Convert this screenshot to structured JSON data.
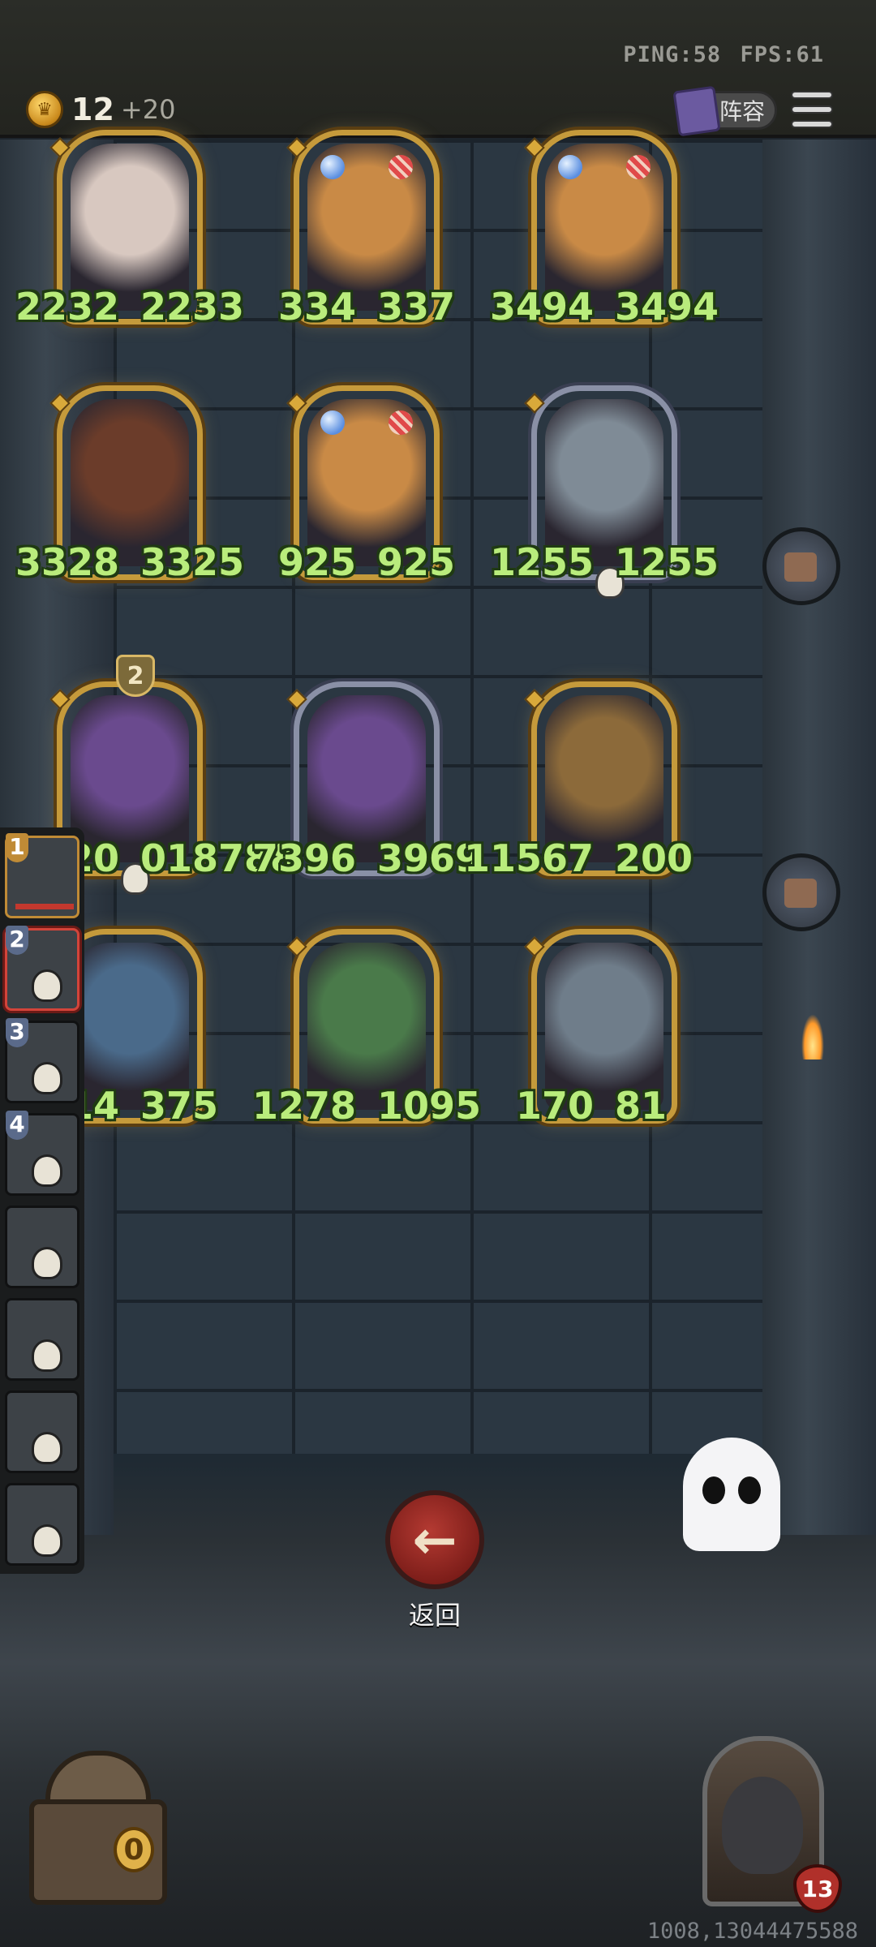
{
  "status": {
    "ping": "PING:58",
    "fps": "FPS:61"
  },
  "currency": {
    "gold": "12",
    "income": "+20"
  },
  "header": {
    "lineup_label": "阵容"
  },
  "cards": [
    {
      "atk": "2232",
      "hp": "2233",
      "frame": "gold",
      "portrait": "rabbit-mask"
    },
    {
      "atk": "334",
      "hp": "337",
      "frame": "gold",
      "portrait": "raccoon"
    },
    {
      "atk": "3494",
      "hp": "3494",
      "frame": "gold",
      "portrait": "raccoon"
    },
    {
      "atk": "3328",
      "hp": "3325",
      "frame": "gold",
      "portrait": "boar"
    },
    {
      "atk": "925",
      "hp": "925",
      "frame": "gold",
      "portrait": "raccoon"
    },
    {
      "atk": "1255",
      "hp": "1255",
      "frame": "silver",
      "portrait": "robot-tin"
    },
    {
      "atk": "320",
      "hp": "018788",
      "frame": "gold",
      "portrait": "dragon-purple",
      "level": "2"
    },
    {
      "atk": "7396",
      "hp": "3969",
      "frame": "silver",
      "portrait": "dragon-purple"
    },
    {
      "atk": "11567",
      "hp": "200",
      "frame": "gold",
      "portrait": "scarecrow"
    },
    {
      "atk": "614",
      "hp": "375",
      "frame": "gold",
      "portrait": "elf-queen"
    },
    {
      "atk": "1278",
      "hp": "1095",
      "frame": "gold",
      "portrait": "green-demon"
    },
    {
      "atk": "170",
      "hp": "81",
      "frame": "gold",
      "portrait": "robot-thinker"
    }
  ],
  "roster": [
    {
      "num": "1"
    },
    {
      "num": "2"
    },
    {
      "num": "3"
    },
    {
      "num": "4"
    },
    {
      "num": ""
    },
    {
      "num": ""
    },
    {
      "num": ""
    },
    {
      "num": ""
    }
  ],
  "actions": {
    "back_icon": "←",
    "back_label": "返回"
  },
  "chest": {
    "count": "0"
  },
  "hero": {
    "hp": "13"
  },
  "footer": {
    "seed": "1008,13044475588"
  },
  "colors": {
    "stat_green": "#b9ec7c",
    "gold_frame": "#c59a3b",
    "silver_frame": "#8a90a6",
    "back_red": "#b43a32"
  }
}
